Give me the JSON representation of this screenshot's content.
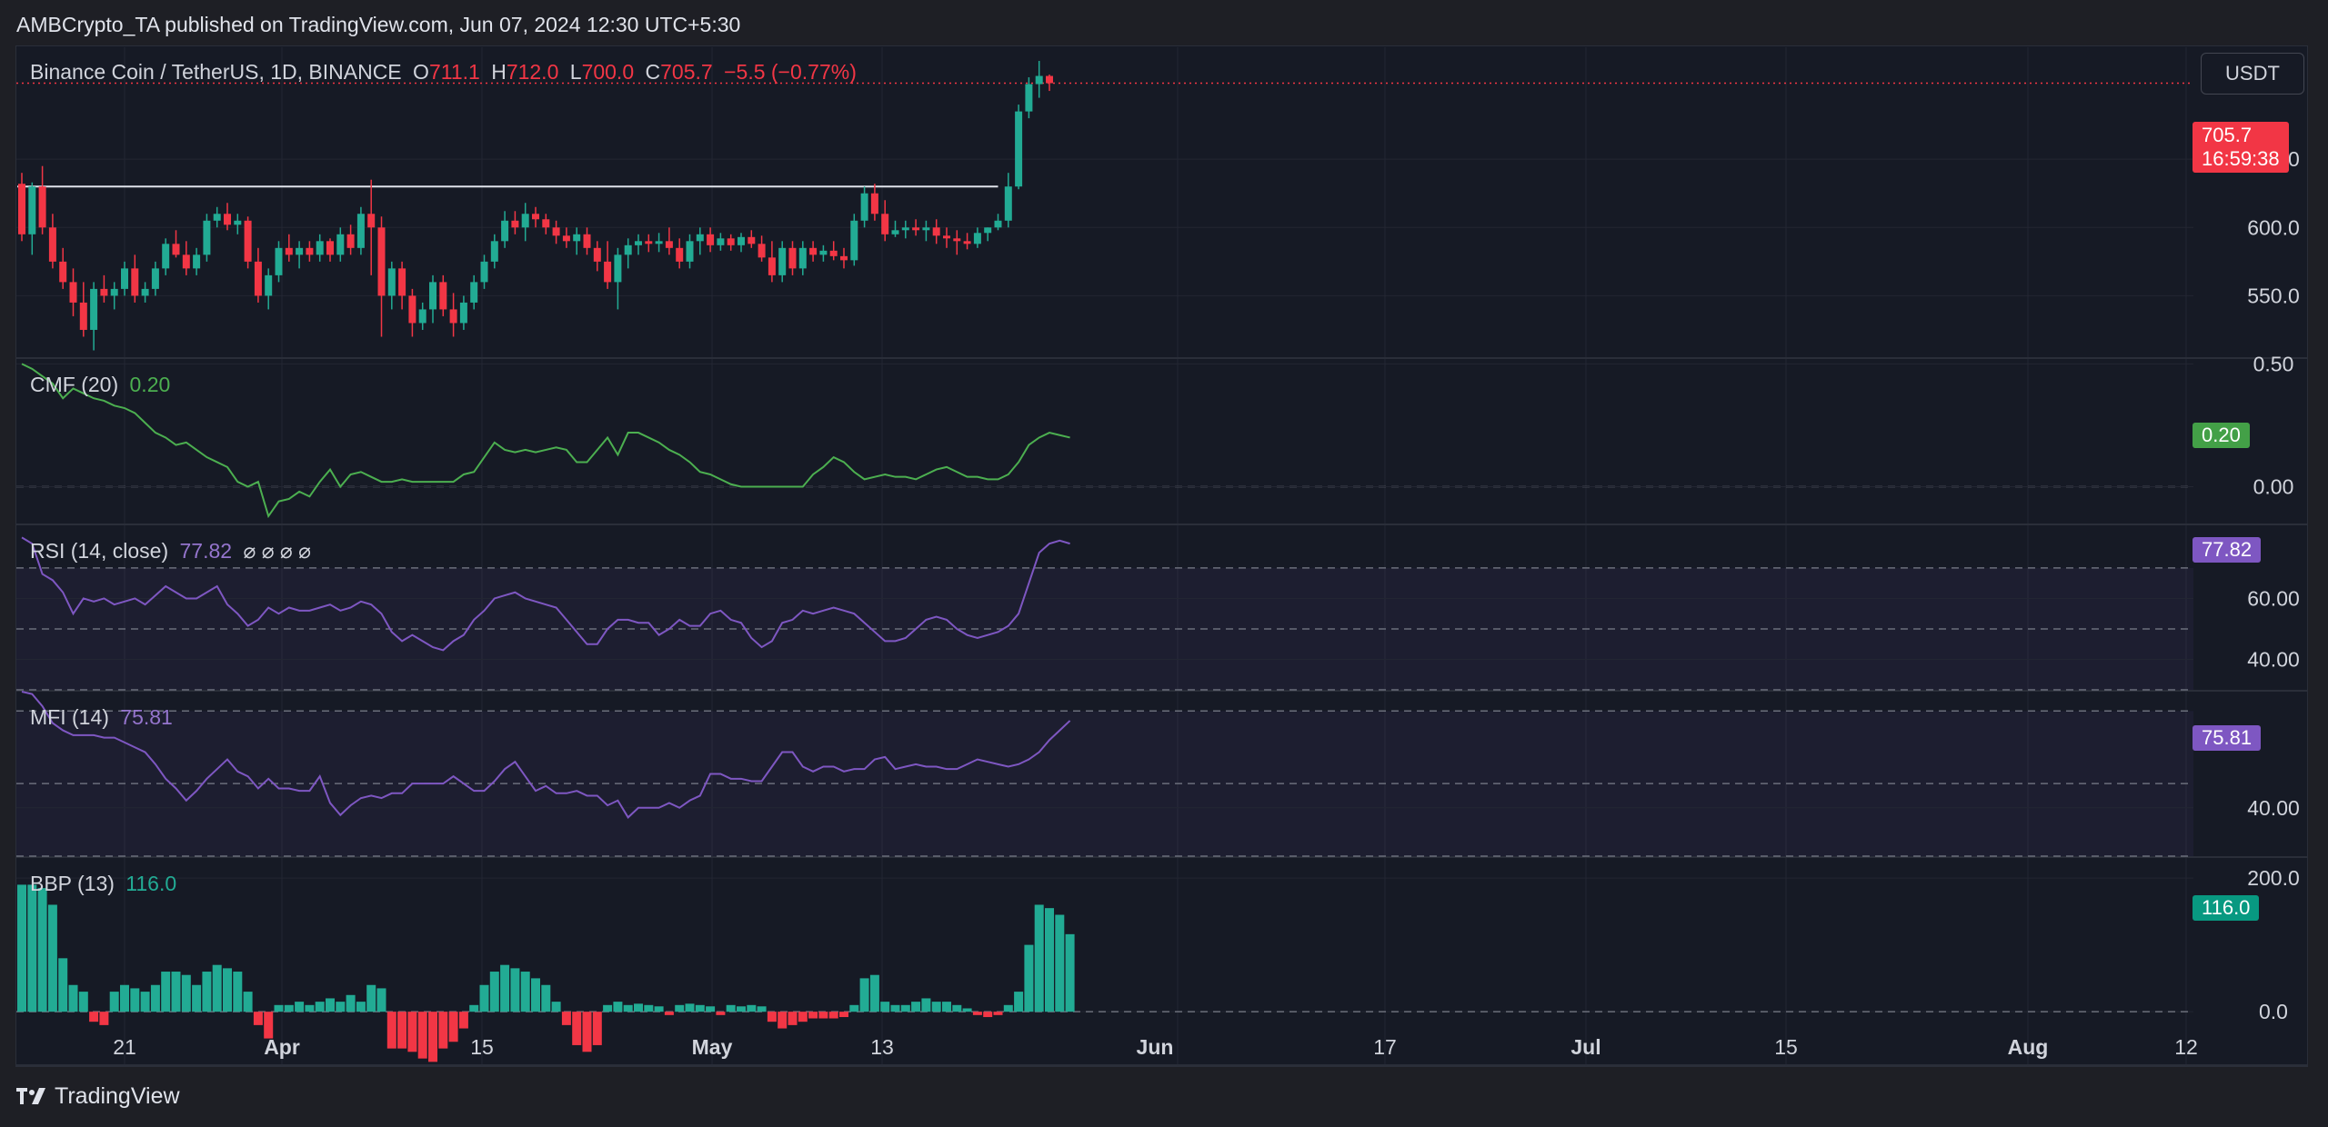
{
  "header": {
    "published": "AMBCrypto_TA published on TradingView.com, Jun 07, 2024 12:30 UTC+5:30"
  },
  "symbol": {
    "name": "Binance Coin / TetherUS, 1D, BINANCE",
    "o_label": "O",
    "o": "711.1",
    "h_label": "H",
    "h": "712.0",
    "l_label": "L",
    "l": "700.0",
    "c_label": "C",
    "c": "705.7",
    "change": "−5.5 (−0.77%)"
  },
  "currency_button": "USDT",
  "price_tag": {
    "price": "705.7",
    "countdown": "16:59:38"
  },
  "indicators": {
    "cmf": {
      "label": "CMF (20)",
      "value": "0.20",
      "tag": "0.20"
    },
    "rsi": {
      "label": "RSI (14, close)",
      "value": "77.82",
      "icons": "⌀ ⌀ ⌀ ⌀",
      "tag": "77.82"
    },
    "mfi": {
      "label": "MFI (14)",
      "value": "75.81",
      "tag": "75.81"
    },
    "bbp": {
      "label": "BBP (13)",
      "value": "116.0",
      "tag": "116.0"
    }
  },
  "footer": {
    "brand": "TradingView"
  },
  "colors": {
    "up": "#22ab94",
    "down": "#f23645",
    "cmf": "#4caf50",
    "rsi": "#7e57c2",
    "mfi": "#7e57c2",
    "bg": "#161a25",
    "grid": "#232632"
  },
  "chart_data": [
    {
      "type": "candlestick",
      "title": "Binance Coin / TetherUS, 1D, BINANCE",
      "x_tick_labels": [
        "21",
        "Apr",
        "15",
        "May",
        "13",
        "Jun",
        "17",
        "Jul",
        "15",
        "Aug",
        "12"
      ],
      "y_tick_labels": [
        "550.0",
        "600.0",
        "650.0"
      ],
      "ylim": [
        505,
        732
      ],
      "resistance_level": 630,
      "last_price": 705.7,
      "ohlc": [
        [
          632,
          640,
          590,
          595
        ],
        [
          595,
          633,
          580,
          630
        ],
        [
          630,
          645,
          595,
          600
        ],
        [
          600,
          610,
          570,
          575
        ],
        [
          575,
          585,
          555,
          560
        ],
        [
          560,
          570,
          535,
          545
        ],
        [
          545,
          560,
          520,
          525
        ],
        [
          525,
          560,
          510,
          555
        ],
        [
          555,
          565,
          545,
          550
        ],
        [
          550,
          560,
          540,
          555
        ],
        [
          555,
          575,
          550,
          570
        ],
        [
          570,
          580,
          545,
          550
        ],
        [
          550,
          560,
          545,
          555
        ],
        [
          555,
          575,
          550,
          570
        ],
        [
          570,
          592,
          565,
          588
        ],
        [
          588,
          598,
          578,
          580
        ],
        [
          580,
          590,
          565,
          570
        ],
        [
          570,
          585,
          565,
          580
        ],
        [
          580,
          610,
          575,
          605
        ],
        [
          605,
          615,
          600,
          610
        ],
        [
          610,
          618,
          598,
          602
        ],
        [
          602,
          610,
          595,
          605
        ],
        [
          605,
          608,
          570,
          575
        ],
        [
          575,
          585,
          545,
          550
        ],
        [
          550,
          570,
          540,
          565
        ],
        [
          565,
          590,
          560,
          585
        ],
        [
          585,
          595,
          575,
          580
        ],
        [
          580,
          590,
          570,
          585
        ],
        [
          585,
          590,
          575,
          580
        ],
        [
          580,
          595,
          575,
          590
        ],
        [
          590,
          592,
          575,
          580
        ],
        [
          580,
          600,
          575,
          595
        ],
        [
          595,
          602,
          580,
          585
        ],
        [
          585,
          615,
          580,
          610
        ],
        [
          610,
          635,
          565,
          600
        ],
        [
          600,
          608,
          520,
          550
        ],
        [
          550,
          575,
          540,
          570
        ],
        [
          570,
          575,
          540,
          550
        ],
        [
          550,
          555,
          520,
          530
        ],
        [
          530,
          545,
          525,
          540
        ],
        [
          540,
          565,
          530,
          560
        ],
        [
          560,
          565,
          535,
          540
        ],
        [
          540,
          552,
          520,
          530
        ],
        [
          530,
          550,
          525,
          545
        ],
        [
          545,
          565,
          540,
          560
        ],
        [
          560,
          580,
          555,
          575
        ],
        [
          575,
          595,
          570,
          590
        ],
        [
          590,
          612,
          585,
          605
        ],
        [
          605,
          612,
          595,
          600
        ],
        [
          600,
          618,
          590,
          610
        ],
        [
          610,
          615,
          600,
          606
        ],
        [
          606,
          610,
          595,
          600
        ],
        [
          600,
          605,
          588,
          594
        ],
        [
          594,
          600,
          585,
          590
        ],
        [
          590,
          600,
          580,
          595
        ],
        [
          595,
          600,
          580,
          585
        ],
        [
          585,
          590,
          568,
          575
        ],
        [
          575,
          590,
          555,
          560
        ],
        [
          560,
          585,
          540,
          580
        ],
        [
          580,
          592,
          570,
          587
        ],
        [
          587,
          595,
          580,
          590
        ],
        [
          590,
          595,
          582,
          588
        ],
        [
          588,
          596,
          582,
          590
        ],
        [
          590,
          600,
          580,
          585
        ],
        [
          585,
          592,
          570,
          575
        ],
        [
          575,
          595,
          570,
          590
        ],
        [
          590,
          600,
          580,
          595
        ],
        [
          595,
          600,
          582,
          587
        ],
        [
          587,
          596,
          583,
          592
        ],
        [
          592,
          595,
          583,
          587
        ],
        [
          587,
          596,
          582,
          593
        ],
        [
          593,
          598,
          585,
          588
        ],
        [
          588,
          594,
          575,
          578
        ],
        [
          578,
          590,
          560,
          565
        ],
        [
          565,
          590,
          560,
          585
        ],
        [
          585,
          590,
          565,
          570
        ],
        [
          570,
          590,
          565,
          585
        ],
        [
          585,
          590,
          575,
          580
        ],
        [
          580,
          587,
          575,
          583
        ],
        [
          583,
          590,
          576,
          579
        ],
        [
          579,
          585,
          570,
          576
        ],
        [
          576,
          610,
          572,
          605
        ],
        [
          605,
          630,
          600,
          625
        ],
        [
          625,
          632,
          605,
          610
        ],
        [
          610,
          620,
          590,
          595
        ],
        [
          595,
          605,
          593,
          598
        ],
        [
          598,
          605,
          592,
          600
        ],
        [
          600,
          606,
          594,
          598
        ],
        [
          598,
          605,
          590,
          600
        ],
        [
          600,
          606,
          588,
          594
        ],
        [
          594,
          600,
          585,
          592
        ],
        [
          592,
          598,
          580,
          590
        ],
        [
          590,
          596,
          584,
          588
        ],
        [
          588,
          600,
          585,
          596
        ],
        [
          596,
          600,
          590,
          600
        ],
        [
          600,
          610,
          598,
          605
        ],
        [
          605,
          640,
          600,
          630
        ],
        [
          630,
          690,
          628,
          685
        ],
        [
          685,
          710,
          680,
          705
        ],
        [
          705,
          722,
          695,
          711
        ],
        [
          711,
          712,
          700,
          705.7
        ]
      ]
    },
    {
      "type": "line",
      "name": "CMF (20)",
      "value_label": "0.20",
      "y_tick_labels": [
        "0.50",
        "0.00"
      ],
      "ylim": [
        -0.15,
        0.52
      ],
      "dashed_level": 0.0,
      "values": [
        0.5,
        0.48,
        0.45,
        0.42,
        0.36,
        0.4,
        0.38,
        0.36,
        0.35,
        0.33,
        0.32,
        0.3,
        0.26,
        0.22,
        0.2,
        0.17,
        0.18,
        0.15,
        0.12,
        0.1,
        0.08,
        0.02,
        0.0,
        0.02,
        -0.12,
        -0.06,
        -0.05,
        -0.02,
        -0.04,
        0.02,
        0.07,
        0.0,
        0.05,
        0.06,
        0.04,
        0.02,
        0.02,
        0.03,
        0.02,
        0.02,
        0.02,
        0.02,
        0.02,
        0.05,
        0.06,
        0.12,
        0.18,
        0.15,
        0.14,
        0.15,
        0.14,
        0.15,
        0.16,
        0.15,
        0.1,
        0.1,
        0.15,
        0.2,
        0.13,
        0.22,
        0.22,
        0.2,
        0.18,
        0.15,
        0.13,
        0.1,
        0.06,
        0.05,
        0.03,
        0.01,
        0.0,
        0.0,
        0.0,
        0.0,
        0.0,
        0.0,
        0.0,
        0.05,
        0.08,
        0.12,
        0.1,
        0.06,
        0.03,
        0.04,
        0.05,
        0.04,
        0.04,
        0.03,
        0.05,
        0.07,
        0.08,
        0.06,
        0.04,
        0.04,
        0.03,
        0.03,
        0.05,
        0.1,
        0.17,
        0.2,
        0.22,
        0.21,
        0.2
      ]
    },
    {
      "type": "line",
      "name": "RSI (14, close)",
      "value_label": "77.82",
      "y_tick_labels": [
        "60.00",
        "40.00"
      ],
      "ylim": [
        30,
        84
      ],
      "bands": [
        70,
        50,
        30
      ],
      "values": [
        80,
        78,
        68,
        66,
        62,
        55,
        60,
        59,
        60,
        58,
        59,
        60,
        58,
        61,
        64,
        62,
        60,
        60,
        62,
        64,
        58,
        55,
        51,
        53,
        57,
        55,
        57,
        56,
        56,
        57,
        58,
        56,
        57,
        59,
        58,
        55,
        49,
        46,
        48,
        46,
        44,
        43,
        46,
        48,
        53,
        56,
        60,
        61,
        62,
        60,
        59,
        58,
        57,
        53,
        49,
        45,
        45,
        50,
        53,
        53,
        52,
        52,
        48,
        50,
        53,
        51,
        51,
        55,
        56,
        53,
        52,
        47,
        44,
        46,
        52,
        53,
        56,
        55,
        56,
        57,
        56,
        55,
        52,
        49,
        46,
        46,
        47,
        50,
        53,
        54,
        53,
        50,
        48,
        47,
        48,
        49,
        51,
        55,
        65,
        75,
        78,
        79,
        78
      ]
    },
    {
      "type": "line",
      "name": "MFI (14)",
      "value_label": "75.81",
      "y_tick_labels": [
        "40.00"
      ],
      "ylim": [
        20,
        88
      ],
      "bands": [
        80,
        50,
        20
      ],
      "values": [
        88,
        87,
        82,
        75,
        72,
        70,
        70,
        70,
        69,
        69,
        67,
        65,
        63,
        58,
        52,
        48,
        43,
        47,
        52,
        56,
        60,
        55,
        53,
        48,
        52,
        48,
        48,
        47,
        47,
        53,
        42,
        37,
        41,
        44,
        45,
        44,
        46,
        46,
        50,
        50,
        50,
        50,
        53,
        50,
        47,
        47,
        51,
        56,
        59,
        53,
        47,
        49,
        46,
        46,
        47,
        45,
        45,
        41,
        43,
        36,
        40,
        40,
        40,
        42,
        40,
        43,
        45,
        54,
        54,
        52,
        52,
        51,
        51,
        57,
        63,
        63,
        57,
        55,
        57,
        57,
        55,
        56,
        56,
        60,
        61,
        56,
        57,
        58,
        57,
        57,
        56,
        56,
        58,
        60,
        59,
        58,
        57,
        58,
        60,
        63,
        68,
        72,
        76
      ]
    },
    {
      "type": "bar",
      "name": "BBP (13)",
      "value_label": "116.0",
      "y_tick_labels": [
        "200.0",
        "0.0"
      ],
      "ylim": [
        -80,
        230
      ],
      "values": [
        190,
        190,
        185,
        160,
        80,
        40,
        30,
        -15,
        -20,
        30,
        40,
        35,
        30,
        40,
        60,
        60,
        55,
        40,
        60,
        70,
        65,
        60,
        30,
        -20,
        -40,
        10,
        10,
        15,
        10,
        15,
        20,
        15,
        25,
        15,
        40,
        35,
        -55,
        -55,
        -60,
        -70,
        -75,
        -55,
        -45,
        -25,
        10,
        40,
        60,
        70,
        65,
        60,
        50,
        40,
        15,
        -20,
        -50,
        -60,
        -50,
        10,
        15,
        10,
        12,
        10,
        8,
        -5,
        10,
        12,
        10,
        8,
        -5,
        10,
        8,
        10,
        8,
        -15,
        -25,
        -20,
        -15,
        -10,
        -10,
        -10,
        -8,
        10,
        50,
        55,
        15,
        10,
        10,
        15,
        20,
        15,
        15,
        10,
        5,
        -5,
        -8,
        -5,
        10,
        30,
        100,
        160,
        155,
        145,
        116
      ]
    }
  ]
}
